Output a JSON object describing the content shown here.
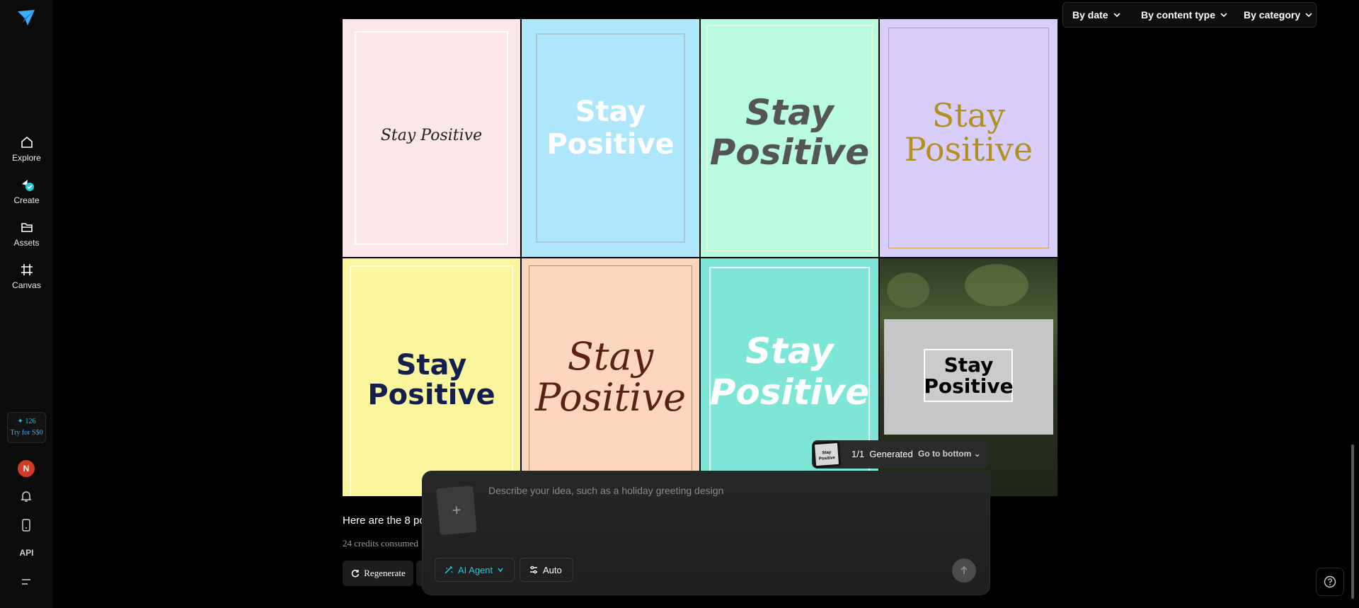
{
  "sidebar": {
    "items": [
      {
        "label": "Explore",
        "icon": "home-icon"
      },
      {
        "label": "Create",
        "icon": "create-icon"
      },
      {
        "label": "Assets",
        "icon": "folder-icon"
      },
      {
        "label": "Canvas",
        "icon": "canvas-icon"
      }
    ],
    "credits": {
      "amount": "126",
      "offer": "Try for S$0"
    },
    "avatar_initial": "N",
    "api_label": "API"
  },
  "filters": {
    "by_date": "By date",
    "by_content_type": "By content type",
    "by_category": "By category"
  },
  "posters": [
    {
      "text1": "Stay Positive",
      "text2": "",
      "bg": "#fbe6ea"
    },
    {
      "text1": "Stay",
      "text2": "Positive",
      "bg": "#aee6fb"
    },
    {
      "text1": "Stay",
      "text2": "Positive",
      "bg": "#b9fbe0"
    },
    {
      "text1": "Stay",
      "text2": "Positive",
      "bg": "#d9cefb"
    },
    {
      "text1": "Stay",
      "text2": "Positive",
      "bg": "#fbf59e"
    },
    {
      "text1": "Stay",
      "text2": "Positive",
      "bg": "#fdd7bd"
    },
    {
      "text1": "Stay",
      "text2": "Positive",
      "bg": "#7ee6d6"
    },
    {
      "text1": "Stay",
      "text2": "Positive",
      "bg": "#c6c6c6"
    }
  ],
  "generated": {
    "count": "1/1",
    "label": "Generated",
    "go_bottom": "Go to bottom",
    "thumb_text": "Stay Positive"
  },
  "message": {
    "text": "Here are the 8 po",
    "credits": "24 credits consumed",
    "regenerate": "Regenerate"
  },
  "composer": {
    "placeholder": "Describe your idea, such as a holiday greeting design",
    "agent": "AI Agent",
    "auto": "Auto"
  },
  "colors": {
    "accent": "#22c7e0",
    "sidebar_bg": "#0b0b0b",
    "avatar": "#d43a2a"
  }
}
